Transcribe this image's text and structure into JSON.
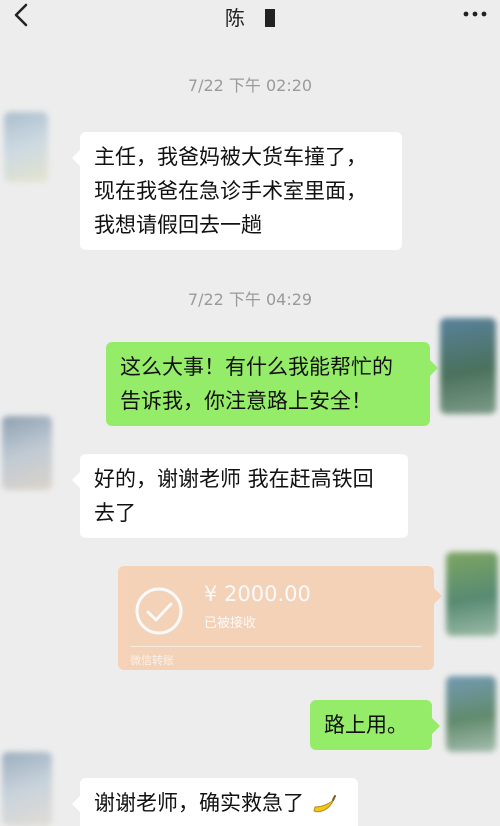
{
  "header": {
    "title": "陈",
    "back_icon": "chevron-left-icon",
    "more_icon": "more-dots-icon"
  },
  "messages": [
    {
      "type": "timestamp",
      "text": "7/22 下午 02:20"
    },
    {
      "type": "incoming",
      "lines": [
        "主任，我爸妈被大货车撞了，",
        "现在我爸在急诊手术室里面，",
        "我想请假回去一趟"
      ]
    },
    {
      "type": "timestamp",
      "text": "7/22 下午 04:29"
    },
    {
      "type": "outgoing",
      "lines": [
        "这么大事！有什么我能帮忙的",
        "告诉我，你注意路上安全！"
      ]
    },
    {
      "type": "incoming",
      "lines": [
        "好的，谢谢老师 我在赶高铁回",
        "去了"
      ]
    },
    {
      "type": "transfer",
      "amount": "¥ 2000.00",
      "status": "已被接收",
      "footer": "微信转账"
    },
    {
      "type": "outgoing",
      "lines": [
        "路上用。"
      ]
    },
    {
      "type": "incoming",
      "lines": [
        "谢谢老师，确实救急了"
      ]
    }
  ],
  "colors": {
    "background": "#ededed",
    "bubble_outgoing": "#95ec69",
    "bubble_incoming": "#ffffff",
    "transfer_card": "#f8c8a4",
    "timestamp_text": "#9a9a9a"
  }
}
